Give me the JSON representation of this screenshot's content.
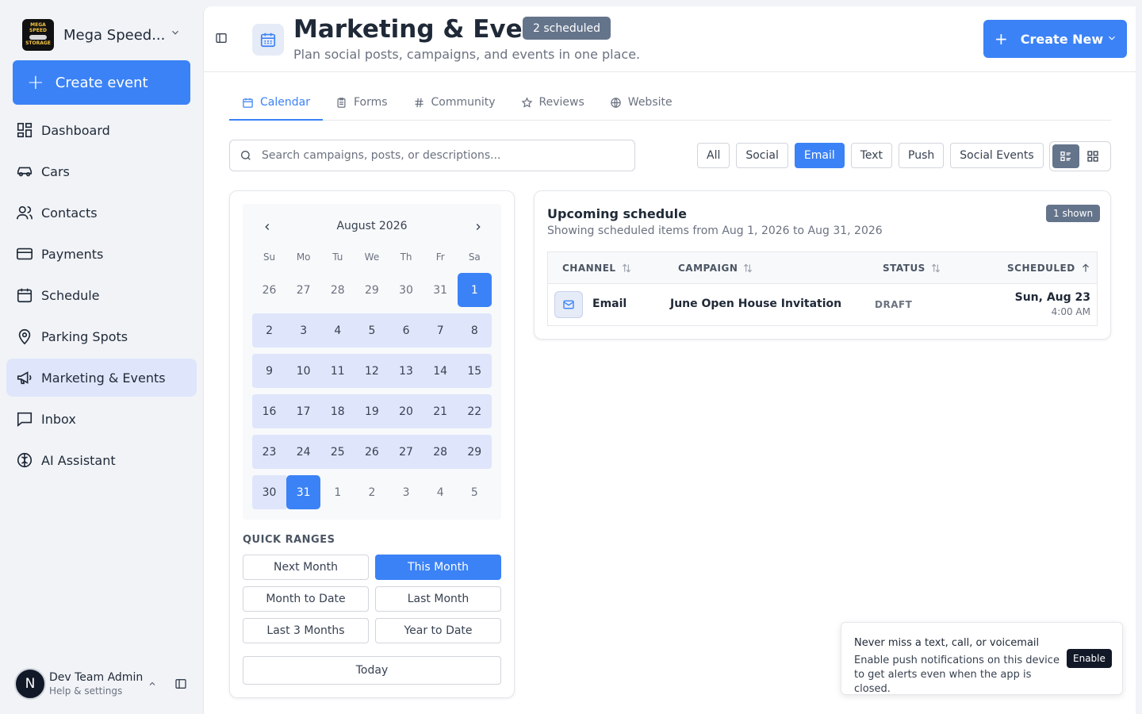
{
  "sidebar": {
    "brand_name": "Mega Speed...",
    "brand_logo_line1": "MEGA SPEED",
    "brand_logo_line2": "STORAGE",
    "create_event_label": "Create event",
    "items": [
      {
        "label": "Dashboard",
        "icon": "dashboard-icon"
      },
      {
        "label": "Cars",
        "icon": "car-icon"
      },
      {
        "label": "Contacts",
        "icon": "users-icon"
      },
      {
        "label": "Payments",
        "icon": "credit-card-icon"
      },
      {
        "label": "Schedule",
        "icon": "calendar-icon"
      },
      {
        "label": "Parking Spots",
        "icon": "map-pin-icon"
      },
      {
        "label": "Marketing & Events",
        "icon": "megaphone-icon",
        "active": true
      },
      {
        "label": "Inbox",
        "icon": "message-icon"
      },
      {
        "label": "AI Assistant",
        "icon": "brain-icon"
      }
    ],
    "user": {
      "initial": "N",
      "name": "Dev Team Admin",
      "subtitle": "Help & settings"
    }
  },
  "header": {
    "title": "Marketing & Events",
    "badge": "2 scheduled",
    "subtitle": "Plan social posts, campaigns, and events in one place.",
    "create_new_label": "Create New"
  },
  "tabs": [
    {
      "label": "Calendar",
      "icon": "calendar-icon",
      "active": true
    },
    {
      "label": "Forms",
      "icon": "clipboard-icon"
    },
    {
      "label": "Community",
      "icon": "hash-icon"
    },
    {
      "label": "Reviews",
      "icon": "star-icon"
    },
    {
      "label": "Website",
      "icon": "globe-icon"
    }
  ],
  "search": {
    "placeholder": "Search campaigns, posts, or descriptions..."
  },
  "filters": [
    {
      "label": "All"
    },
    {
      "label": "Social"
    },
    {
      "label": "Email",
      "active": true
    },
    {
      "label": "Text"
    },
    {
      "label": "Push"
    },
    {
      "label": "Social Events"
    }
  ],
  "calendar": {
    "month_label": "August 2026",
    "weekdays": [
      "Su",
      "Mo",
      "Tu",
      "We",
      "Th",
      "Fr",
      "Sa"
    ],
    "weeks": [
      [
        "26",
        "27",
        "28",
        "29",
        "30",
        "31",
        "1"
      ],
      [
        "2",
        "3",
        "4",
        "5",
        "6",
        "7",
        "8"
      ],
      [
        "9",
        "10",
        "11",
        "12",
        "13",
        "14",
        "15"
      ],
      [
        "16",
        "17",
        "18",
        "19",
        "20",
        "21",
        "22"
      ],
      [
        "23",
        "24",
        "25",
        "26",
        "27",
        "28",
        "29"
      ],
      [
        "30",
        "31",
        "1",
        "2",
        "3",
        "4",
        "5"
      ]
    ],
    "range_start": "1",
    "range_end": "31"
  },
  "quick_ranges": {
    "title": "QUICK RANGES",
    "buttons": [
      "Next Month",
      "This Month",
      "Month to Date",
      "Last Month",
      "Last 3 Months",
      "Year to Date"
    ],
    "active": "This Month",
    "today_label": "Today"
  },
  "schedule": {
    "title": "Upcoming schedule",
    "subtitle": "Showing scheduled items from Aug 1, 2026 to Aug 31, 2026",
    "shown_badge": "1 shown",
    "columns": [
      "CHANNEL",
      "CAMPAIGN",
      "STATUS",
      "SCHEDULED"
    ],
    "rows": [
      {
        "channel": "Email",
        "campaign": "June Open House Invitation",
        "status": "DRAFT",
        "date": "Sun, Aug 23",
        "time": "4:00 AM"
      }
    ]
  },
  "toast": {
    "title": "Never miss a text, call, or voicemail",
    "body": "Enable push notifications on this device to get alerts even when the app is closed.",
    "button": "Enable"
  },
  "colors": {
    "accent": "#3b82f6",
    "accent_light": "#dfe6fb",
    "badge": "#64748b"
  }
}
